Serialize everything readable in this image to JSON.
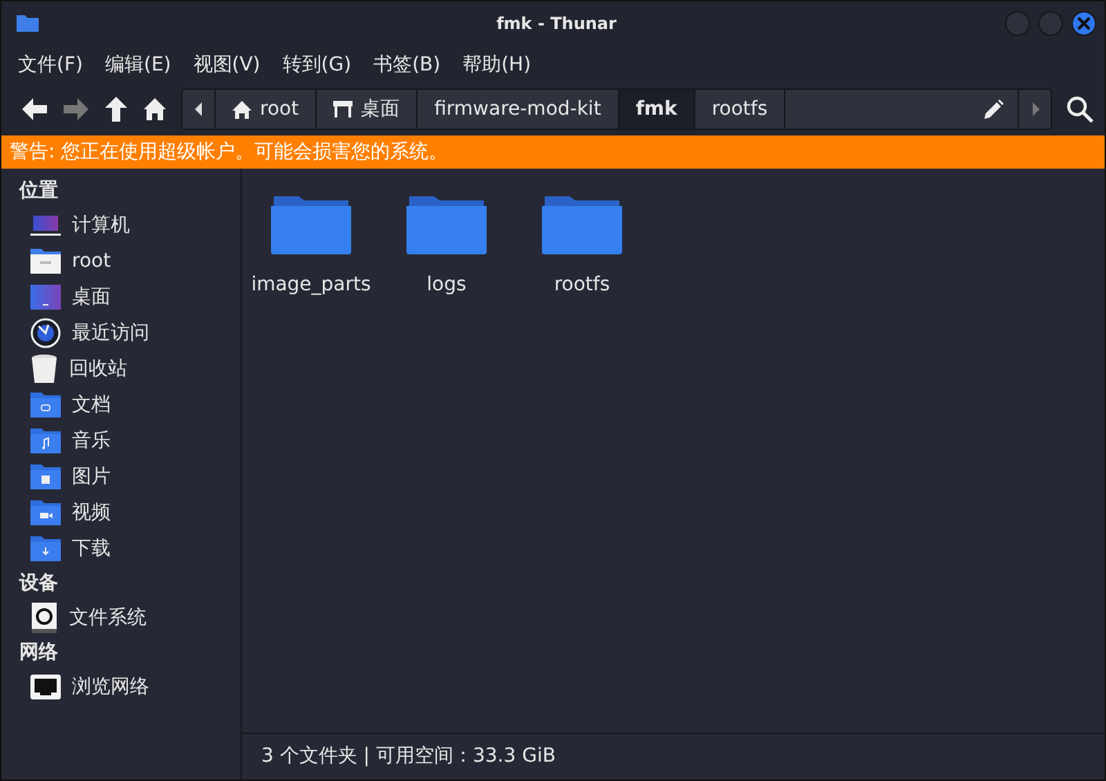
{
  "window": {
    "title": "fmk - Thunar"
  },
  "menu": [
    "文件(F)",
    "编辑(E)",
    "视图(V)",
    "转到(G)",
    "书签(B)",
    "帮助(H)"
  ],
  "toolbar": {
    "back_disabled": false,
    "forward_disabled": true
  },
  "path": [
    {
      "label": "root",
      "kind": "home",
      "selected": false
    },
    {
      "label": "桌面",
      "kind": "desktop",
      "selected": false
    },
    {
      "label": "firmware-mod-kit",
      "selected": false
    },
    {
      "label": "fmk",
      "selected": true
    },
    {
      "label": "rootfs",
      "selected": false
    }
  ],
  "warning": "警告: 您正在使用超级帐户。可能会损害您的系统。",
  "sidebar": [
    {
      "heading": "位置",
      "items": [
        {
          "label": "计算机",
          "kind": "computer"
        },
        {
          "label": "root",
          "kind": "home"
        },
        {
          "label": "桌面",
          "kind": "desktop"
        },
        {
          "label": "最近访问",
          "kind": "recent"
        },
        {
          "label": "回收站",
          "kind": "trash"
        },
        {
          "label": "文档",
          "kind": "documents"
        },
        {
          "label": "音乐",
          "kind": "music"
        },
        {
          "label": "图片",
          "kind": "pictures"
        },
        {
          "label": "视频",
          "kind": "videos"
        },
        {
          "label": "下载",
          "kind": "downloads"
        }
      ]
    },
    {
      "heading": "设备",
      "items": [
        {
          "label": "文件系统",
          "kind": "drive"
        }
      ]
    },
    {
      "heading": "网络",
      "items": [
        {
          "label": "浏览网络",
          "kind": "network"
        }
      ]
    }
  ],
  "files": [
    {
      "name": "image_parts"
    },
    {
      "name": "logs"
    },
    {
      "name": "rootfs"
    }
  ],
  "status_bar": "3 个文件夹 | 可用空间：33.3 GiB"
}
